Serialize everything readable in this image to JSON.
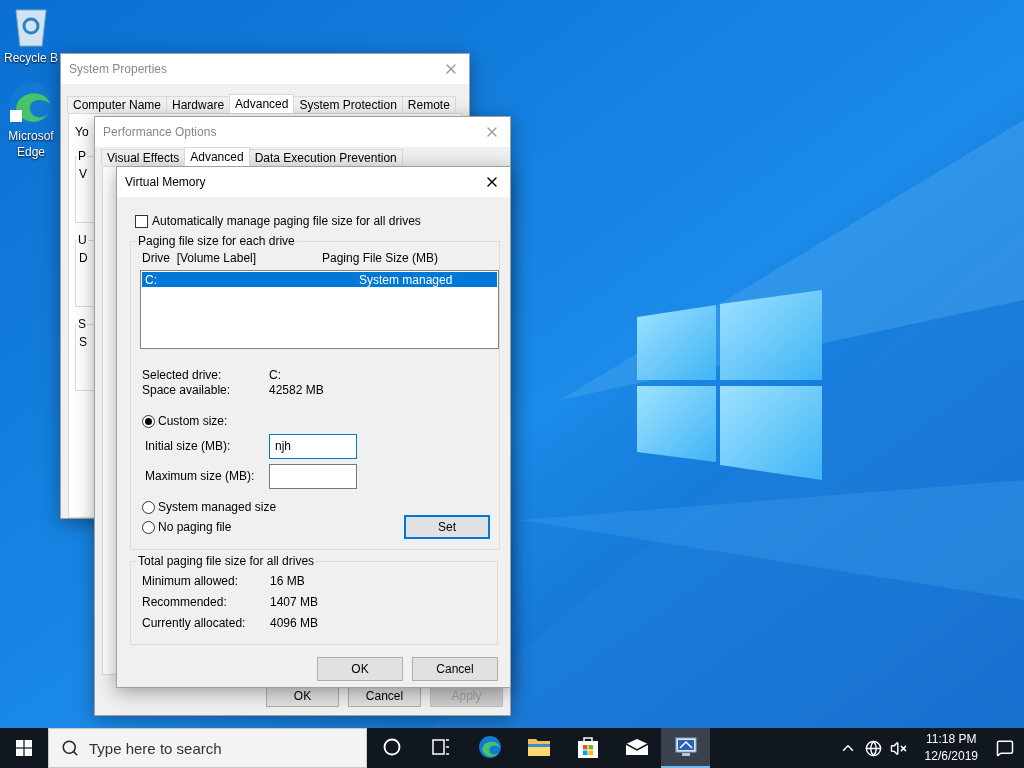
{
  "desktop_icons": [
    {
      "kind": "recycle-bin",
      "label_lines": [
        "Recycle B"
      ]
    },
    {
      "kind": "edge",
      "label_lines": [
        "Microsof",
        "Edge"
      ]
    }
  ],
  "system_properties": {
    "title": "System Properties",
    "active": false,
    "tabs": [
      {
        "label": "Computer Name",
        "selected": false
      },
      {
        "label": "Hardware",
        "selected": false
      },
      {
        "label": "Advanced",
        "selected": true
      },
      {
        "label": "System Protection",
        "selected": false
      },
      {
        "label": "Remote",
        "selected": false
      }
    ],
    "intro": "Yo",
    "groups": [
      {
        "title": "P",
        "lines": [
          "V"
        ]
      },
      {
        "title": "U",
        "lines": [
          "D"
        ]
      },
      {
        "title": "S",
        "lines": [
          "S"
        ]
      }
    ]
  },
  "performance_options": {
    "title": "Performance Options",
    "active": false,
    "tabs": [
      {
        "label": "Visual Effects",
        "selected": false
      },
      {
        "label": "Advanced",
        "selected": true
      },
      {
        "label": "Data Execution Prevention",
        "selected": false
      }
    ],
    "buttons": [
      {
        "label": "OK",
        "disabled": false
      },
      {
        "label": "Cancel",
        "disabled": false
      },
      {
        "label": "Apply",
        "disabled": true
      }
    ]
  },
  "virtual_memory": {
    "title": "Virtual Memory",
    "active": true,
    "auto_manage": {
      "label": "Automatically manage paging file size for all drives",
      "checked": false
    },
    "drive_group": {
      "title": "Paging file size for each drive",
      "columns": [
        "Drive  [Volume Label]",
        "Paging File Size (MB)"
      ],
      "drives": [
        {
          "drive": "C:",
          "size": "System managed",
          "selected": true
        }
      ],
      "info": [
        {
          "label": "Selected drive:",
          "value": "C:"
        },
        {
          "label": "Space available:",
          "value": "42582 MB"
        }
      ],
      "size_options": [
        {
          "label": "Custom size:",
          "selected": true
        },
        {
          "label": "System managed size",
          "selected": false
        },
        {
          "label": "No paging file",
          "selected": false
        }
      ],
      "fields": [
        {
          "label": "Initial size (MB):",
          "value": "njh",
          "focused": true
        },
        {
          "label": "Maximum size (MB):",
          "focused": false
        }
      ],
      "set_button": "Set"
    },
    "total_group": {
      "title": "Total paging file size for all drives",
      "rows": [
        {
          "label": "Minimum allowed:",
          "value": "16 MB"
        },
        {
          "label": "Recommended:",
          "value": "1407 MB"
        },
        {
          "label": "Currently allocated:",
          "value": "4096 MB"
        }
      ]
    },
    "buttons": [
      "OK",
      "Cancel"
    ]
  },
  "taskbar": {
    "search": {
      "placeholder": "Type here to search"
    },
    "apps": [
      {
        "kind": "cortana",
        "selected": false
      },
      {
        "kind": "task-view",
        "selected": false
      },
      {
        "kind": "edge",
        "selected": false
      },
      {
        "kind": "explorer",
        "selected": false
      },
      {
        "kind": "store",
        "selected": false
      },
      {
        "kind": "mail",
        "selected": false
      },
      {
        "kind": "monitor",
        "selected": true
      }
    ],
    "tray": {
      "time": "11:18 PM",
      "date": "12/6/2019"
    }
  }
}
